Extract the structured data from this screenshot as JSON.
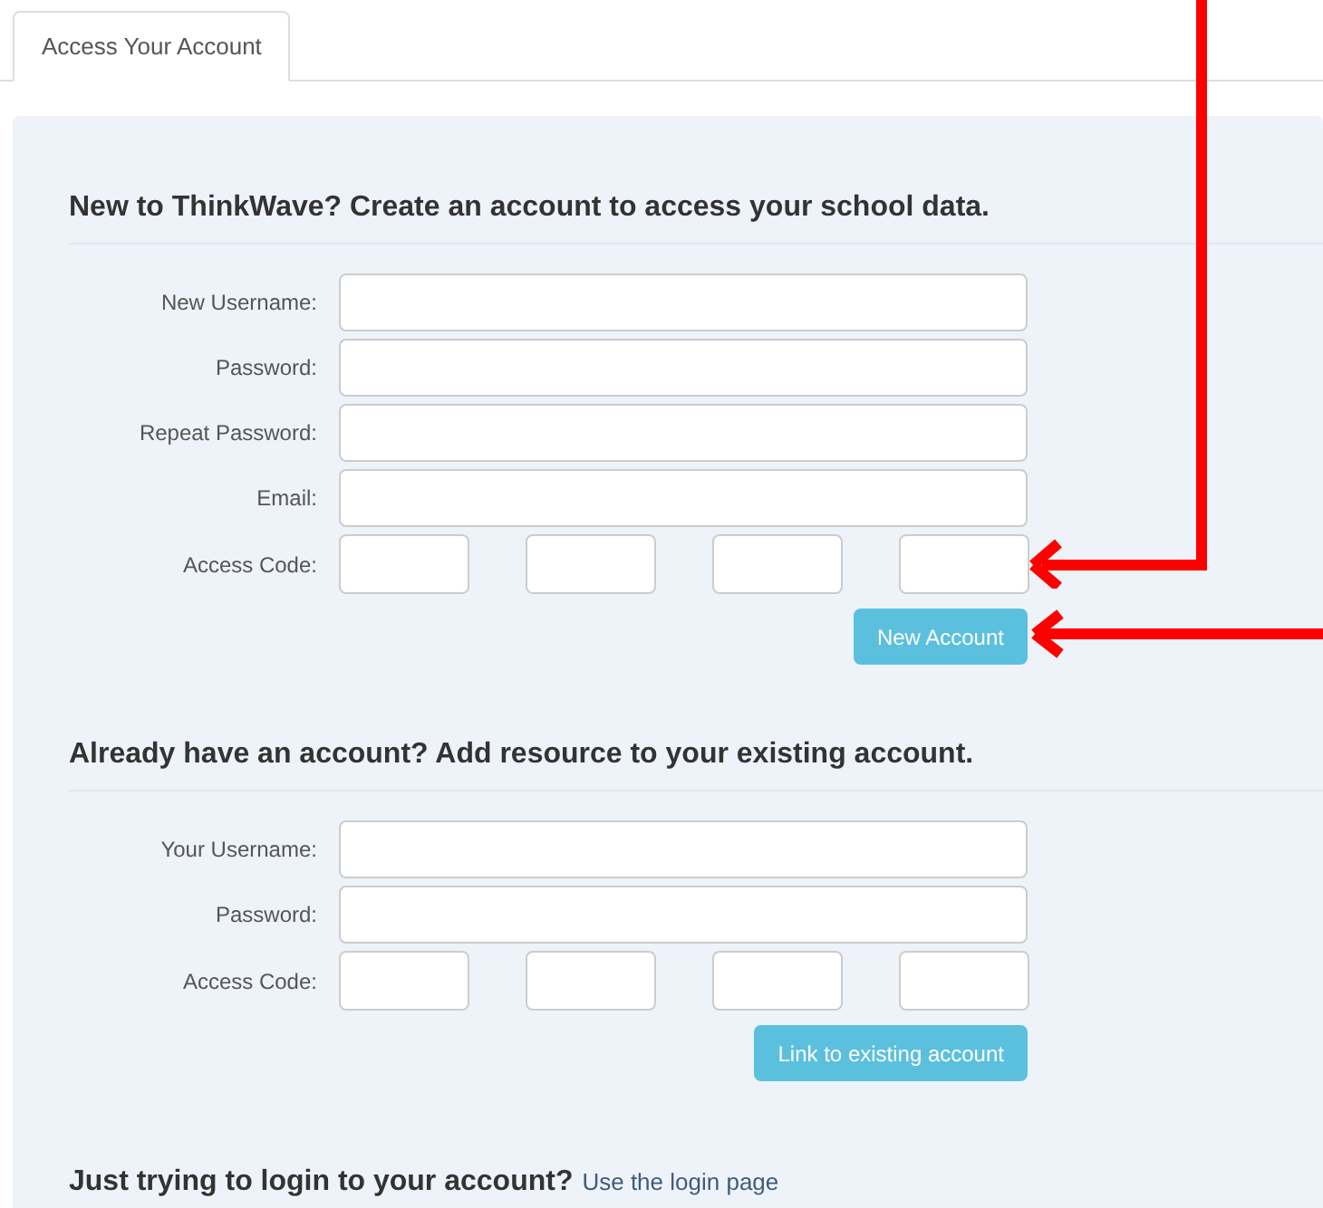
{
  "tabs": [
    {
      "label": "Access Your Account",
      "selected": true
    }
  ],
  "sections": [
    {
      "heading": "New to ThinkWave? Create an account to access your school data.",
      "fields": [
        {
          "kind": "text",
          "label": "New Username:"
        },
        {
          "kind": "text",
          "label": "Password:"
        },
        {
          "kind": "text",
          "label": "Repeat Password:"
        },
        {
          "kind": "text",
          "label": "Email:"
        },
        {
          "kind": "code",
          "label": "Access Code:"
        }
      ],
      "button": "New Account"
    },
    {
      "heading": "Already have an account? Add resource to your existing account.",
      "fields": [
        {
          "kind": "text",
          "label": "Your Username:"
        },
        {
          "kind": "text",
          "label": "Password:"
        },
        {
          "kind": "code",
          "label": "Access Code:"
        }
      ],
      "button": "Link to existing account"
    }
  ],
  "footer": {
    "question": "Just trying to login to your account?",
    "link": "Use the login page"
  }
}
